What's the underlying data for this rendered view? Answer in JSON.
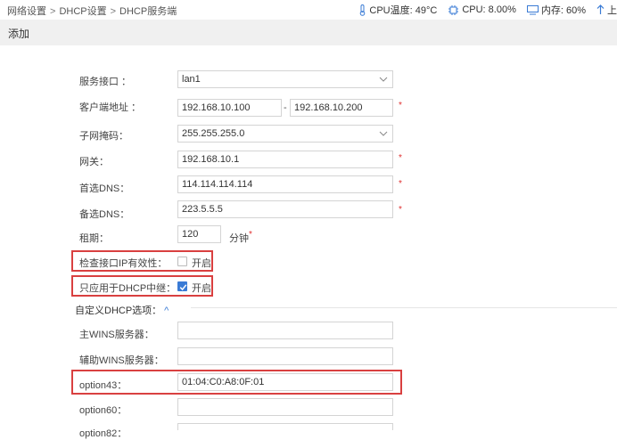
{
  "breadcrumb": [
    "网络设置",
    "DHCP设置",
    "DHCP服务端"
  ],
  "breadcrumb_sep": ">",
  "status": {
    "cpu_temp": "CPU温度: 49°C",
    "cpu": "CPU: 8.00%",
    "memory": "内存: 60%",
    "up_label": "上"
  },
  "page_title": "添加",
  "form": {
    "interface": {
      "label": "服务接口 ：",
      "value": "lan1"
    },
    "client_address": {
      "label": "客户端地址 ：",
      "start": "192.168.10.100",
      "separator": "-",
      "end": "192.168.10.200"
    },
    "subnet_mask": {
      "label": "子网掩码：",
      "value": "255.255.255.0"
    },
    "gateway": {
      "label": "网关：",
      "value": "192.168.10.1"
    },
    "primary_dns": {
      "label": "首选DNS：",
      "value": "114.114.114.114"
    },
    "secondary_dns": {
      "label": "备选DNS：",
      "value": "223.5.5.5"
    },
    "lease": {
      "label": "租期：",
      "value": "120",
      "unit": "分钟"
    },
    "required_mark": "*",
    "check_ip": {
      "label": "检查接口IP有效性：",
      "option": "开启",
      "checked": false
    },
    "relay_only": {
      "label": "只应用于DHCP中继：",
      "option": "开启",
      "checked": true
    }
  },
  "custom_section": {
    "label": "自定义DHCP选项：",
    "caret": "^"
  },
  "custom": {
    "primary_wins": {
      "label": "主WINS服务器：",
      "value": ""
    },
    "secondary_wins": {
      "label": "辅助WINS服务器：",
      "value": ""
    },
    "option43": {
      "label": "option43：",
      "value": "01:04:C0:A8:0F:01"
    },
    "option60": {
      "label": "option60：",
      "value": ""
    },
    "option_next": {
      "label": "option82：",
      "value": ""
    }
  },
  "colors": {
    "accent": "#3a7bd5",
    "highlight": "#d94040",
    "required": "#e03030"
  }
}
